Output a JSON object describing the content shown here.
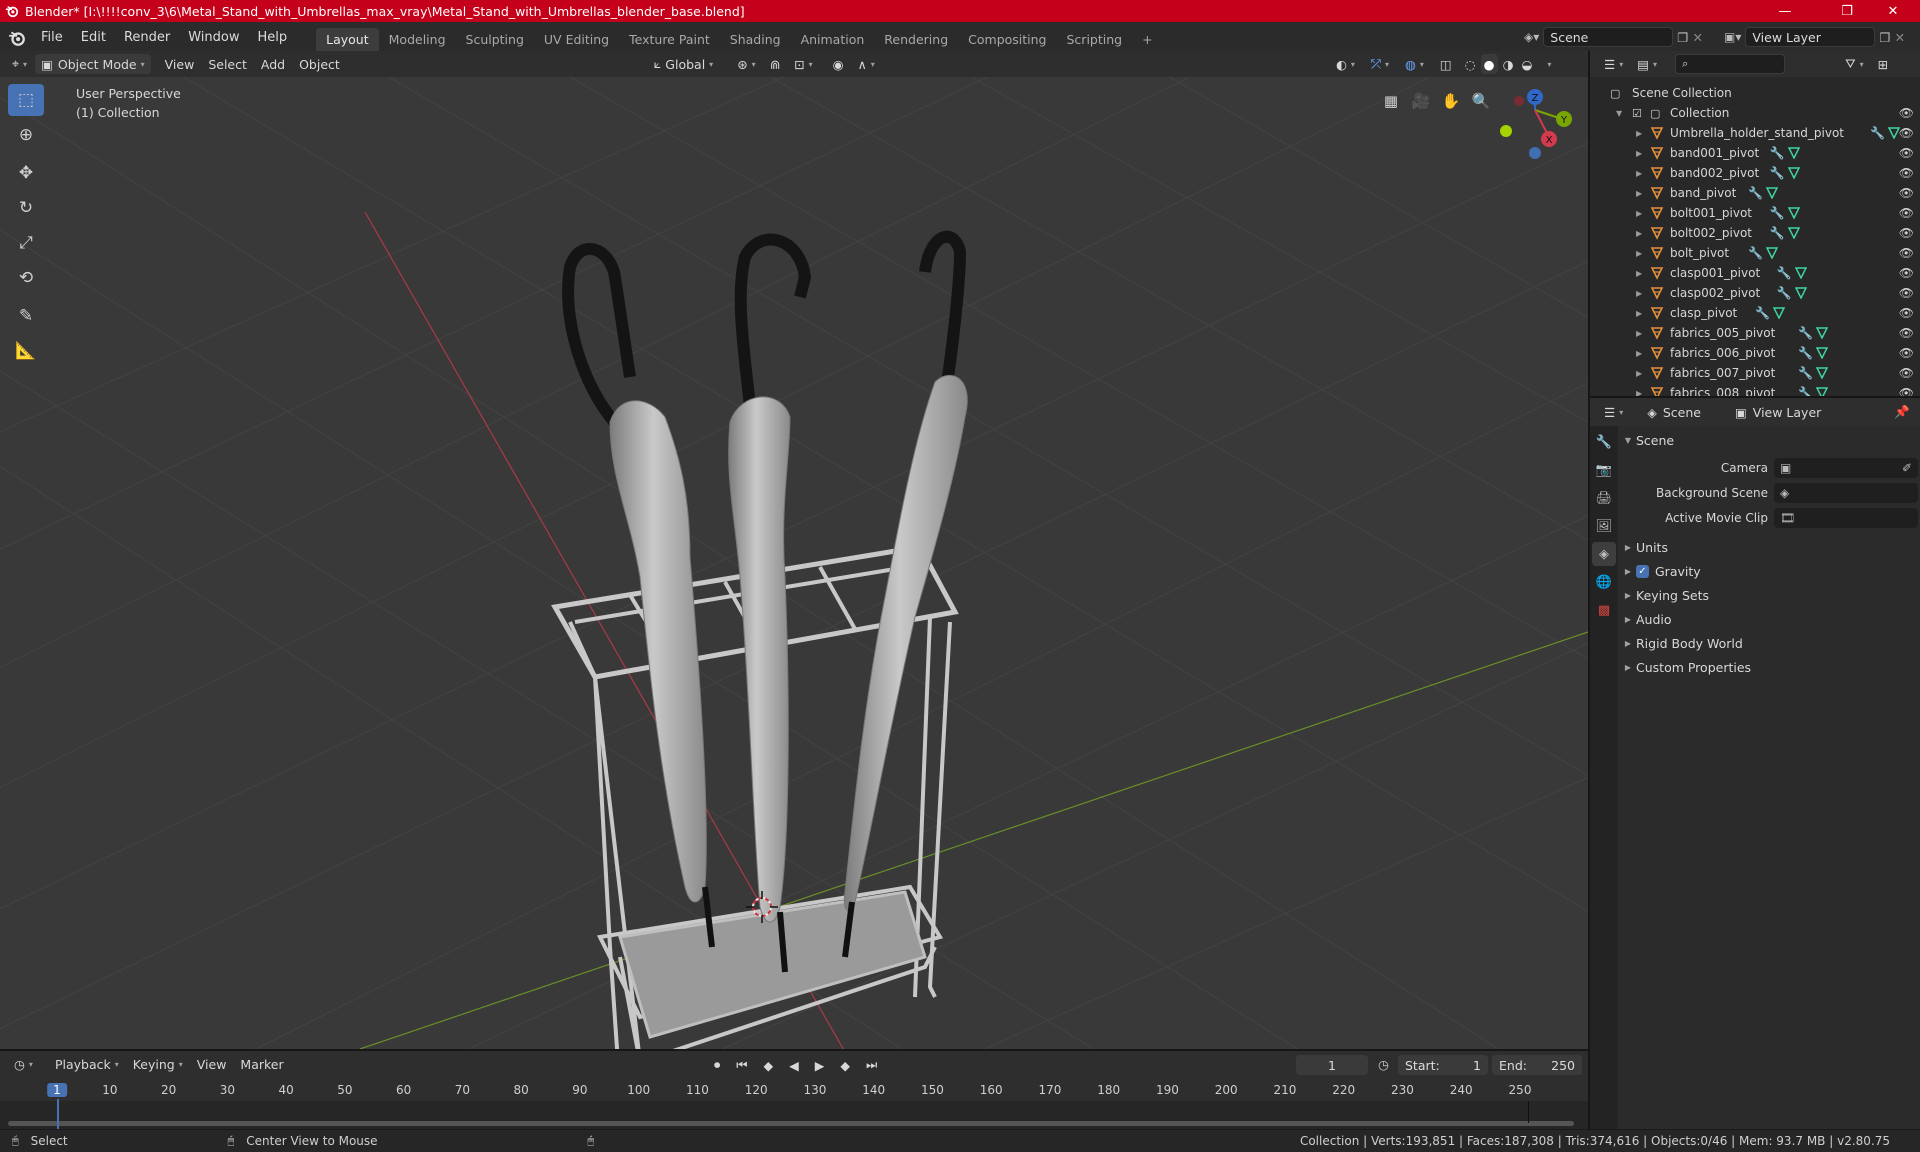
{
  "window": {
    "title": "Blender* [I:\\!!!!conv_3\\6\\Metal_Stand_with_Umbrellas_max_vray\\Metal_Stand_with_Umbrellas_blender_base.blend]",
    "minimize": "—",
    "maximize": "❐",
    "close": "✕"
  },
  "menu": [
    "File",
    "Edit",
    "Render",
    "Window",
    "Help"
  ],
  "workspaces": [
    "Layout",
    "Modeling",
    "Sculpting",
    "UV Editing",
    "Texture Paint",
    "Shading",
    "Animation",
    "Rendering",
    "Compositing",
    "Scripting"
  ],
  "workspace_add": "+",
  "scene_selector": {
    "value": "Scene"
  },
  "viewlayer_selector": {
    "value": "View Layer"
  },
  "viewport_header": {
    "mode": "Object Mode",
    "menus": [
      "View",
      "Select",
      "Add",
      "Object"
    ],
    "orientation": "Global"
  },
  "viewport": {
    "perspective_label": "User Perspective",
    "collection_label": "(1) Collection",
    "gizmo": {
      "x": "X",
      "y": "Y",
      "z": "Z"
    },
    "axis_colors": {
      "x": "#ff3352",
      "y": "#8bdc00",
      "z": "#2890ff"
    }
  },
  "outliner": {
    "search_placeholder": "",
    "root": "Scene Collection",
    "collection": "Collection",
    "items": [
      "Umbrella_holder_stand_pivot",
      "band001_pivot",
      "band002_pivot",
      "band_pivot",
      "bolt001_pivot",
      "bolt002_pivot",
      "bolt_pivot",
      "clasp001_pivot",
      "clasp002_pivot",
      "clasp_pivot",
      "fabrics_005_pivot",
      "fabrics_006_pivot",
      "fabrics_007_pivot",
      "fabrics_008_pivot"
    ]
  },
  "properties": {
    "tabs": [
      "Scene",
      "View Layer"
    ],
    "panel_title": "Scene",
    "fields": [
      {
        "label": "Camera"
      },
      {
        "label": "Background Scene"
      },
      {
        "label": "Active Movie Clip"
      }
    ],
    "collapsed_panels": [
      "Units",
      "Gravity",
      "Keying Sets",
      "Audio",
      "Rigid Body World",
      "Custom Properties"
    ]
  },
  "timeline": {
    "menus": [
      "Playback",
      "Keying",
      "View",
      "Marker"
    ],
    "current_frame": "1",
    "start_label": "Start:",
    "start": "1",
    "end_label": "End:",
    "end": "250",
    "ticks": [
      "1",
      "10",
      "20",
      "30",
      "40",
      "50",
      "60",
      "70",
      "80",
      "90",
      "100",
      "110",
      "120",
      "130",
      "140",
      "150",
      "160",
      "170",
      "180",
      "190",
      "200",
      "210",
      "220",
      "230",
      "240",
      "250"
    ]
  },
  "status": {
    "left": "Select",
    "middle": "Center View to Mouse",
    "right": "Collection | Verts:193,851 | Faces:187,308 | Tris:374,616 | Objects:0/46 | Mem: 93.7 MB | v2.80.75"
  }
}
